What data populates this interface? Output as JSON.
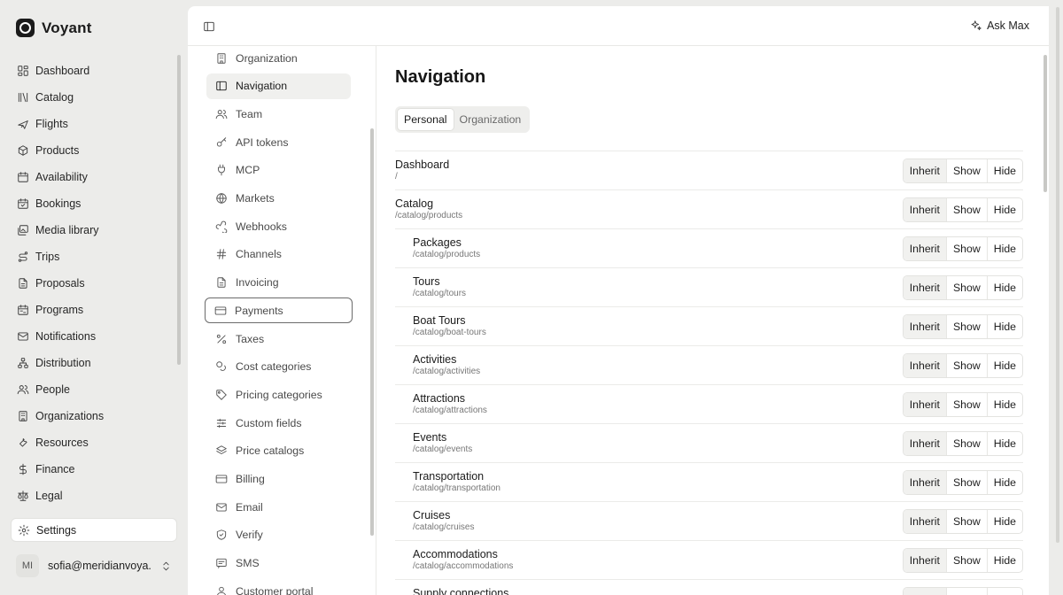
{
  "app": {
    "name": "Voyant"
  },
  "sidebar": {
    "items": [
      {
        "label": "Dashboard",
        "icon": "dashboard-icon"
      },
      {
        "label": "Catalog",
        "icon": "library-icon"
      },
      {
        "label": "Flights",
        "icon": "plane-icon"
      },
      {
        "label": "Products",
        "icon": "box-icon"
      },
      {
        "label": "Availability",
        "icon": "calendar-icon"
      },
      {
        "label": "Bookings",
        "icon": "calendar-check-icon"
      },
      {
        "label": "Media library",
        "icon": "images-icon"
      },
      {
        "label": "Trips",
        "icon": "route-icon"
      },
      {
        "label": "Proposals",
        "icon": "document-icon"
      },
      {
        "label": "Programs",
        "icon": "calendar-range-icon"
      },
      {
        "label": "Notifications",
        "icon": "mail-icon"
      },
      {
        "label": "Distribution",
        "icon": "network-icon"
      },
      {
        "label": "People",
        "icon": "users-icon"
      },
      {
        "label": "Organizations",
        "icon": "building-icon"
      },
      {
        "label": "Resources",
        "icon": "wrench-icon"
      },
      {
        "label": "Finance",
        "icon": "dollar-icon"
      },
      {
        "label": "Legal",
        "icon": "scale-icon"
      }
    ],
    "settings_label": "Settings",
    "user": {
      "initials": "MI",
      "email": "sofia@meridianvoya..."
    }
  },
  "topbar": {
    "ask_label": "Ask Max"
  },
  "subnav": {
    "items": [
      {
        "label": "Organization",
        "icon": "building-icon"
      },
      {
        "label": "Navigation",
        "icon": "sidebar-icon",
        "active": true
      },
      {
        "label": "Team",
        "icon": "users-icon"
      },
      {
        "label": "API tokens",
        "icon": "key-icon"
      },
      {
        "label": "MCP",
        "icon": "plug-icon"
      },
      {
        "label": "Markets",
        "icon": "globe-icon"
      },
      {
        "label": "Webhooks",
        "icon": "webhook-icon"
      },
      {
        "label": "Channels",
        "icon": "hash-icon"
      },
      {
        "label": "Invoicing",
        "icon": "document-icon"
      },
      {
        "label": "Payments",
        "icon": "credit-card-icon",
        "focused": true
      },
      {
        "label": "Taxes",
        "icon": "percent-icon"
      },
      {
        "label": "Cost categories",
        "icon": "coins-icon"
      },
      {
        "label": "Pricing categories",
        "icon": "tag-icon"
      },
      {
        "label": "Custom fields",
        "icon": "sliders-icon"
      },
      {
        "label": "Price catalogs",
        "icon": "layers-icon"
      },
      {
        "label": "Billing",
        "icon": "credit-card-icon"
      },
      {
        "label": "Email",
        "icon": "mail-icon"
      },
      {
        "label": "Verify",
        "icon": "shield-icon"
      },
      {
        "label": "SMS",
        "icon": "message-icon"
      },
      {
        "label": "Customer portal",
        "icon": "user-icon"
      }
    ]
  },
  "page": {
    "title": "Navigation",
    "tabs": [
      {
        "label": "Personal",
        "active": true
      },
      {
        "label": "Organization",
        "active": false
      }
    ],
    "options": [
      "Inherit",
      "Show",
      "Hide"
    ],
    "rows": [
      {
        "name": "Dashboard",
        "path": "/",
        "indent": false,
        "value": "Inherit"
      },
      {
        "name": "Catalog",
        "path": "/catalog/products",
        "indent": false,
        "value": "Inherit"
      },
      {
        "name": "Packages",
        "path": "/catalog/products",
        "indent": true,
        "value": "Inherit"
      },
      {
        "name": "Tours",
        "path": "/catalog/tours",
        "indent": true,
        "value": "Inherit"
      },
      {
        "name": "Boat Tours",
        "path": "/catalog/boat-tours",
        "indent": true,
        "value": "Inherit"
      },
      {
        "name": "Activities",
        "path": "/catalog/activities",
        "indent": true,
        "value": "Inherit"
      },
      {
        "name": "Attractions",
        "path": "/catalog/attractions",
        "indent": true,
        "value": "Inherit"
      },
      {
        "name": "Events",
        "path": "/catalog/events",
        "indent": true,
        "value": "Inherit"
      },
      {
        "name": "Transportation",
        "path": "/catalog/transportation",
        "indent": true,
        "value": "Inherit"
      },
      {
        "name": "Cruises",
        "path": "/catalog/cruises",
        "indent": true,
        "value": "Inherit"
      },
      {
        "name": "Accommodations",
        "path": "/catalog/accommodations",
        "indent": true,
        "value": "Inherit"
      },
      {
        "name": "Supply connections",
        "path": "",
        "indent": true,
        "value": "Inherit"
      }
    ]
  }
}
